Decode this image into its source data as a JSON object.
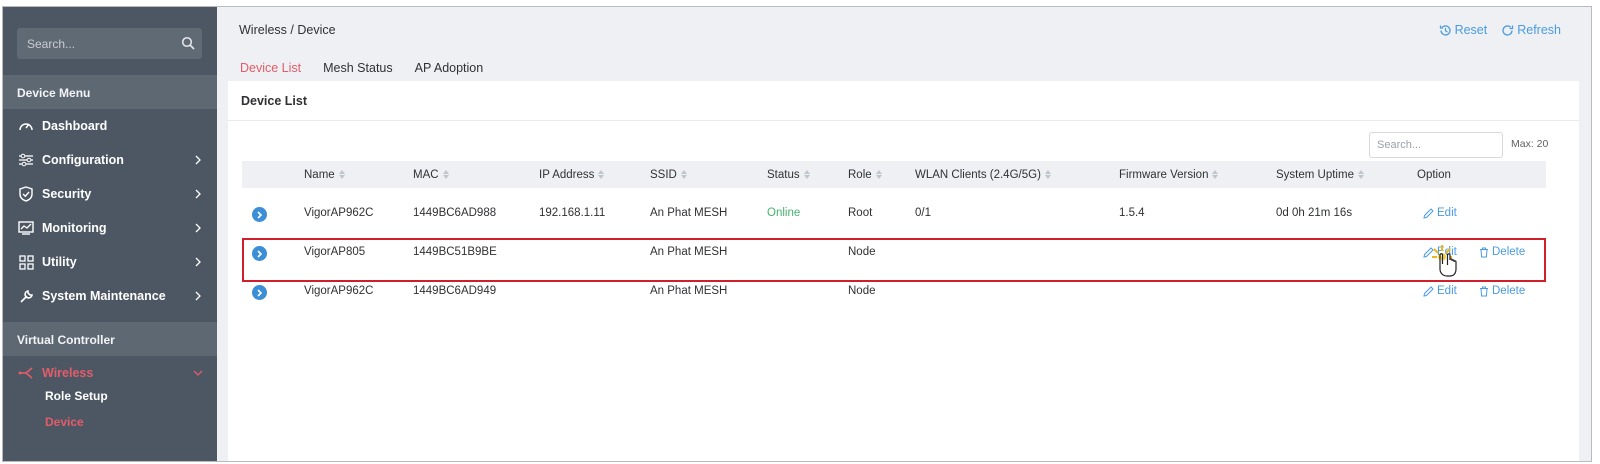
{
  "sidebar": {
    "search_placeholder": "Search...",
    "device_menu_heading": "Device Menu",
    "items": [
      {
        "label": "Dashboard",
        "icon": "dashboard-icon"
      },
      {
        "label": "Configuration",
        "icon": "sliders-icon"
      },
      {
        "label": "Security",
        "icon": "shield-icon"
      },
      {
        "label": "Monitoring",
        "icon": "monitor-icon"
      },
      {
        "label": "Utility",
        "icon": "grid-icon"
      },
      {
        "label": "System Maintenance",
        "icon": "wrench-icon"
      }
    ],
    "virtual_controller_heading": "Virtual Controller",
    "wireless": {
      "label": "Wireless",
      "icon": "wireless-icon"
    },
    "sub_items": [
      {
        "label": "Role Setup"
      },
      {
        "label": "Device"
      }
    ]
  },
  "header": {
    "breadcrumb": "Wireless / Device",
    "reset_label": "Reset",
    "refresh_label": "Refresh"
  },
  "tabs": [
    {
      "label": "Device List",
      "active": true
    },
    {
      "label": "Mesh Status",
      "active": false
    },
    {
      "label": "AP Adoption",
      "active": false
    }
  ],
  "panel": {
    "title": "Device List",
    "search_placeholder": "Search...",
    "max_label": "Max: 20"
  },
  "table": {
    "columns": [
      "Name",
      "MAC",
      "IP Address",
      "SSID",
      "Status",
      "Role",
      "WLAN Clients (2.4G/5G)",
      "Firmware Version",
      "System Uptime",
      "Option"
    ],
    "rows": [
      {
        "name": "VigorAP962C",
        "mac": "1449BC6AD988",
        "ip": "192.168.1.11",
        "ssid": "An Phat MESH",
        "status": "Online",
        "role": "Root",
        "clients": "0/1",
        "firmware": "1.5.4",
        "uptime": "0d 0h 21m 16s",
        "edit": "Edit",
        "delete": ""
      },
      {
        "name": "VigorAP805",
        "mac": "1449BC51B9BE",
        "ip": "",
        "ssid": "An Phat MESH",
        "status": "",
        "role": "Node",
        "clients": "",
        "firmware": "",
        "uptime": "",
        "edit": "Edit",
        "delete": "Delete"
      },
      {
        "name": "VigorAP962C",
        "mac": "1449BC6AD949",
        "ip": "",
        "ssid": "An Phat MESH",
        "status": "",
        "role": "Node",
        "clients": "",
        "firmware": "",
        "uptime": "",
        "edit": "Edit",
        "delete": "Delete"
      }
    ]
  },
  "colors": {
    "accent": "#e35c6a",
    "link": "#4a9be0",
    "online": "#47b36d",
    "sidebar": "#4d5763",
    "highlight": "#d01f2b"
  }
}
